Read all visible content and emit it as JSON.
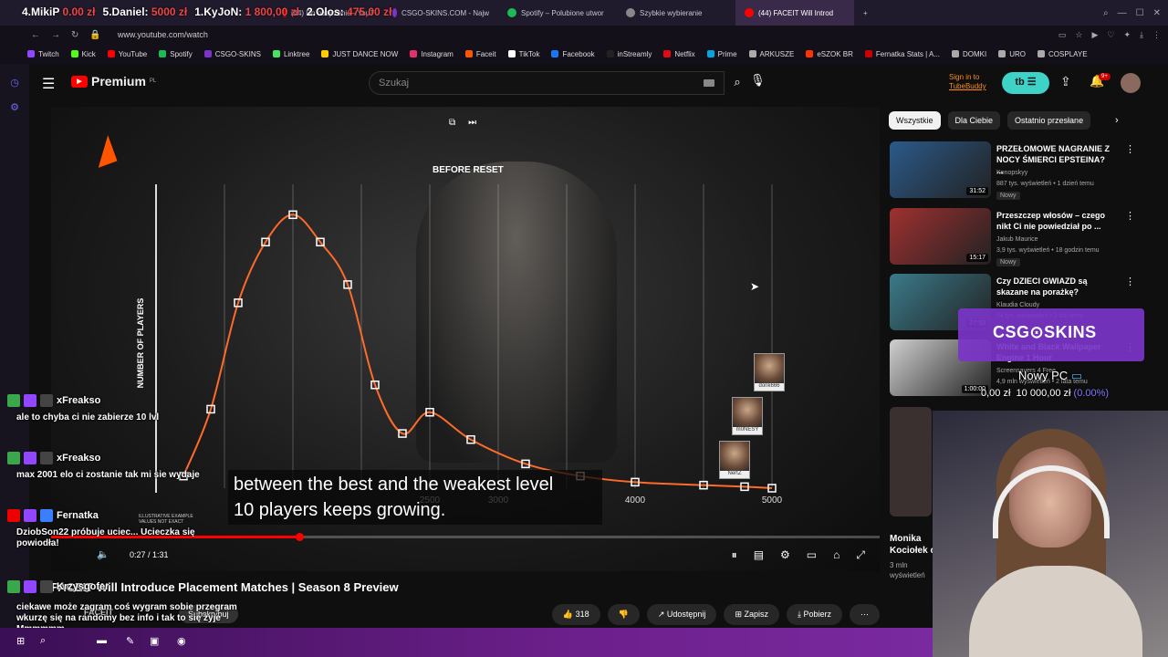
{
  "browser": {
    "overlay_ranking": [
      {
        "text": "4.MikiP",
        "value": "0.00 zł"
      },
      {
        "text": "5.Daniel:",
        "value": "5000 zł"
      },
      {
        "text": "1.KyJoN:",
        "value": "1 800,00 zł"
      },
      {
        "text": "2.Olos:",
        "value": "475,00 zł"
      }
    ],
    "tabs": [
      {
        "label": "(44) Do obejrzenia - YouT",
        "active": false,
        "color": "#ff0000"
      },
      {
        "label": "CSGO-SKINS.COM - Najw",
        "active": false,
        "color": "#7a35c8"
      },
      {
        "label": "Spotify – Polubione utwor",
        "active": false,
        "color": "#1db954"
      },
      {
        "label": "Szybkie wybieranie",
        "active": false,
        "color": "#888888"
      },
      {
        "label": "(44) FACEIT Will Introd",
        "active": true,
        "color": "#ff0000"
      }
    ],
    "url": "www.youtube.com/watch",
    "bookmarks": [
      {
        "label": "Twitch",
        "color": "#9146ff"
      },
      {
        "label": "Kick",
        "color": "#53fc18"
      },
      {
        "label": "YouTube",
        "color": "#ff0000"
      },
      {
        "label": "Spotify",
        "color": "#1db954"
      },
      {
        "label": "CSGO-SKINS",
        "color": "#7a35c8"
      },
      {
        "label": "Linktree",
        "color": "#43e660"
      },
      {
        "label": "JUST DANCE NOW",
        "color": "#ffcc00"
      },
      {
        "label": "Instagram",
        "color": "#e1306c"
      },
      {
        "label": "Faceit",
        "color": "#ff5500"
      },
      {
        "label": "TikTok",
        "color": "#ffffff"
      },
      {
        "label": "Facebook",
        "color": "#1877f2"
      },
      {
        "label": "inStreamly",
        "color": "#222222"
      },
      {
        "label": "Netflix",
        "color": "#e50914"
      },
      {
        "label": "Prime",
        "color": "#00a8e1"
      },
      {
        "label": "ARKUSZE",
        "color": "#aaaaaa"
      },
      {
        "label": "eSZOK BR",
        "color": "#ff3300"
      },
      {
        "label": "Fernatka Stats | A...",
        "color": "#cc0000"
      },
      {
        "label": "DOMKI",
        "color": "#aaaaaa"
      },
      {
        "label": "URO",
        "color": "#aaaaaa"
      },
      {
        "label": "COSPLAYE",
        "color": "#aaaaaa"
      }
    ]
  },
  "youtube": {
    "logo_text": "Premium",
    "logo_region": "PL",
    "search_placeholder": "Szukaj",
    "tubebuddy_line1": "Sign in to",
    "tubebuddy_line2": "TubeBuddy",
    "notifications": "9+"
  },
  "video": {
    "chart_title": "BEFORE RESET",
    "y_label": "NUMBER OF PLAYERS",
    "illustrative_1": "ILLUSTRATIVE EXAMPLE",
    "illustrative_2": "VALUES NOT EXACT",
    "caption_line1": "between the best and the weakest level",
    "caption_line2": "10 players keeps growing.",
    "time": "0:27 / 1:31",
    "players": [
      "donk666",
      "m0NESY",
      "NertZ"
    ],
    "title": "FACEIT Will Introduce Placement Matches | Season 8 Preview",
    "channel": "FACEIT",
    "subscribe": "Subskrybuj",
    "likes": "318",
    "share": "Udostępnij",
    "save": "Zapisz",
    "download": "Pobierz"
  },
  "chart_data": {
    "type": "line",
    "title": "BEFORE RESET",
    "xlabel": "",
    "ylabel": "NUMBER OF PLAYERS",
    "x_ticks": [
      "2500",
      "3000",
      "4000",
      "5000"
    ],
    "xlim": [
      500,
      5000
    ],
    "ylim": [
      0,
      100
    ],
    "grid": true,
    "series": [
      {
        "x": [
          700,
          900,
          1100,
          1300,
          1500,
          1700,
          1900,
          2100,
          2300,
          2500,
          2800,
          3200,
          3600,
          4000,
          4500,
          4800,
          5000
        ],
        "y": [
          4,
          26,
          61,
          81,
          90,
          81,
          67,
          34,
          18,
          25,
          16,
          8,
          4,
          2,
          1,
          0.5,
          0
        ]
      }
    ]
  },
  "sidebar": {
    "chips": [
      "Wszystkie",
      "Dla Ciebie",
      "Ostatnio przesłane"
    ],
    "recs": [
      {
        "title": "PRZEŁOMOWE NAGRANIE Z NOCY ŚMIERCI EPSTEINA? ...",
        "channel": "Konopskyy",
        "stats": "887 tys. wyświetleń • 1 dzień temu",
        "badge": "Nowy",
        "duration": "31:52",
        "color": "#2b5a8a"
      },
      {
        "title": "Przeszczep włosów – czego nikt Ci nie powiedział po ...",
        "channel": "Jakub Maurice",
        "stats": "3,9 tys. wyświetleń • 18 godzin temu",
        "badge": "Nowy",
        "duration": "15:17",
        "color": "#a03030"
      },
      {
        "title": "Czy DZIECI GWIAZD są skazane na porażkę?",
        "channel": "Klaudia Cloudy",
        "stats": "24 tys. wyświetleń • 2 dni temu",
        "badge": "",
        "duration": "27:53",
        "color": "#3a7a8a"
      },
      {
        "title": "White and Black Wallpaper Engine 1 Hour",
        "channel": "Screensavers 4 Free",
        "stats": "4,9 mln wyświetleń • 2 lata temu",
        "badge": "",
        "duration": "1:00:00",
        "color": "#d0d0d0"
      }
    ],
    "bottom_title_1": "Monika",
    "bottom_title_2": "Kociołek c",
    "bottom_meta_1": "3 mln",
    "bottom_meta_2": "wyświetleń"
  },
  "stream": {
    "csgo_logo": "CSG⊙SKINS",
    "goal_title": "Nowy PC",
    "goal_current": "0,00 zł",
    "goal_target": "10 000,00 zł",
    "goal_pct": "(0.00%)"
  },
  "chat": [
    {
      "name": "xFreakso",
      "text": "ale to chyba ci nie zabierze 10 lvl",
      "name_color": "#ffffff"
    },
    {
      "name": "xFreakso",
      "text": "max 2001 elo ci zostanie tak mi sie wydaje",
      "name_color": "#ffffff"
    },
    {
      "name": "Fernatka",
      "text": "DziobSon22 próbuje uciec... Ucieczka się powiodła!",
      "name_color": "#ffffff"
    },
    {
      "name": "Krzysgofer",
      "text": "ciekawe może zagram coś wygram sobie przegram wkurzę się na randomy bez info i tak to się żyje Mmmmmm",
      "name_color": "#ffffff"
    }
  ]
}
